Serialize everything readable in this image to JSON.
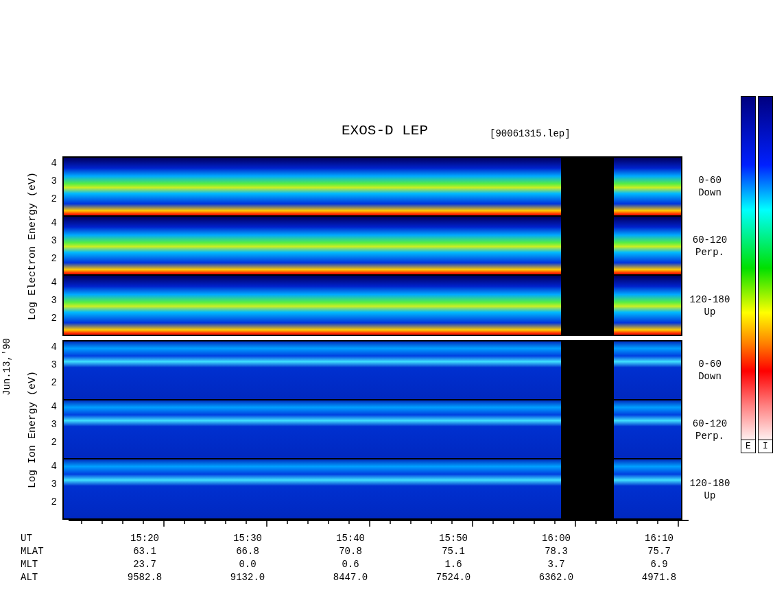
{
  "title": "EXOS-D LEP",
  "file_label": "[90061315.lep]",
  "date_label": "Jun.13,'90",
  "groups": [
    {
      "kind": "electron",
      "axis_label": "Log Electron Energy (eV)",
      "panels": [
        {
          "yticks": [
            "4",
            "3",
            "2"
          ],
          "angle": "0-60",
          "direction": "Down"
        },
        {
          "yticks": [
            "4",
            "3",
            "2"
          ],
          "angle": "60-120",
          "direction": "Perp."
        },
        {
          "yticks": [
            "4",
            "3",
            "2"
          ],
          "angle": "120-180",
          "direction": "Up"
        }
      ]
    },
    {
      "kind": "ion",
      "axis_label": "Log Ion Energy (eV)",
      "panels": [
        {
          "yticks": [
            "4",
            "3",
            "2"
          ],
          "angle": "0-60",
          "direction": "Down"
        },
        {
          "yticks": [
            "4",
            "3",
            "2"
          ],
          "angle": "60-120",
          "direction": "Perp."
        },
        {
          "yticks": [
            "4",
            "3",
            "2"
          ],
          "angle": "120-180",
          "direction": "Up"
        }
      ]
    }
  ],
  "time_axis": [
    {
      "label": "UT",
      "values": [
        "15:20",
        "15:30",
        "15:40",
        "15:50",
        "16:00",
        "16:10"
      ]
    },
    {
      "label": "MLAT",
      "values": [
        "63.1",
        "66.8",
        "70.8",
        "75.1",
        "78.3",
        "75.7"
      ]
    },
    {
      "label": "MLT",
      "values": [
        "23.7",
        "0.0",
        "0.6",
        "1.6",
        "3.7",
        "6.9"
      ]
    },
    {
      "label": "ALT",
      "values": [
        "9582.8",
        "9132.0",
        "8447.0",
        "7524.0",
        "6362.0",
        "4971.8"
      ]
    }
  ],
  "colorbars": [
    {
      "label": "E"
    },
    {
      "label": "I"
    }
  ]
}
